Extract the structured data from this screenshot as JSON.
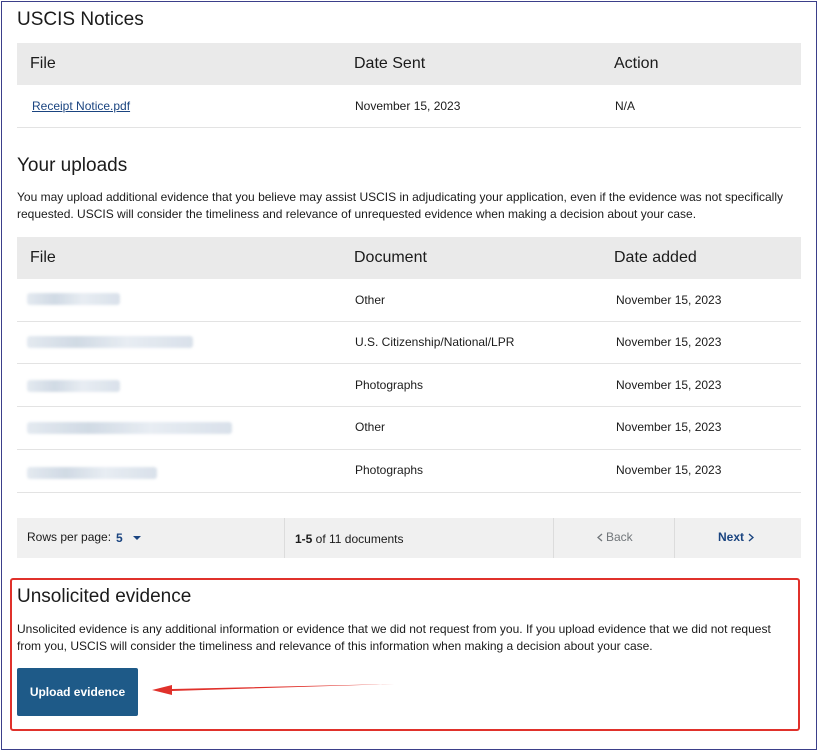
{
  "notices": {
    "title": "USCIS Notices",
    "columns": [
      "File",
      "Date Sent",
      "Action"
    ],
    "rows": [
      {
        "file": "Receipt Notice.pdf",
        "date": "November 15, 2023",
        "action": "N/A"
      }
    ]
  },
  "uploads": {
    "title": "Your uploads",
    "description": "You may upload additional evidence that you believe may assist USCIS in adjudicating your application, even if the evidence was not specifically requested. USCIS will consider the timeliness and relevance of unrequested evidence when making a decision about your case.",
    "columns": [
      "File",
      "Document",
      "Date added"
    ],
    "rows": [
      {
        "document": "Other",
        "date": "November 15, 2023"
      },
      {
        "document": "U.S. Citizenship/National/LPR",
        "date": "November 15, 2023"
      },
      {
        "document": "Photographs",
        "date": "November 15, 2023"
      },
      {
        "document": "Other",
        "date": "November 15, 2023"
      },
      {
        "document": "Photographs",
        "date": "November 15, 2023"
      }
    ]
  },
  "pagination": {
    "rows_per_page_label": "Rows per page:",
    "rows_per_page_value": "5",
    "range_bold": "1-5",
    "range_rest": " of 11 documents",
    "back_label": "Back",
    "next_label": "Next"
  },
  "unsolicited": {
    "title": "Unsolicited evidence",
    "description": "Unsolicited evidence is any additional information or evidence that we did not request from you. If you upload evidence that we did not request from you, USCIS will consider the timeliness and relevance of this information when making a decision about your case.",
    "button_label": "Upload evidence"
  },
  "colors": {
    "link": "#1a4480",
    "button": "#1e5a88",
    "annotation": "#e0312b",
    "header_bg": "#eaeaea"
  },
  "icons": [
    "chevron-down-icon",
    "chevron-left-icon",
    "chevron-right-icon",
    "arrow-annotation"
  ]
}
